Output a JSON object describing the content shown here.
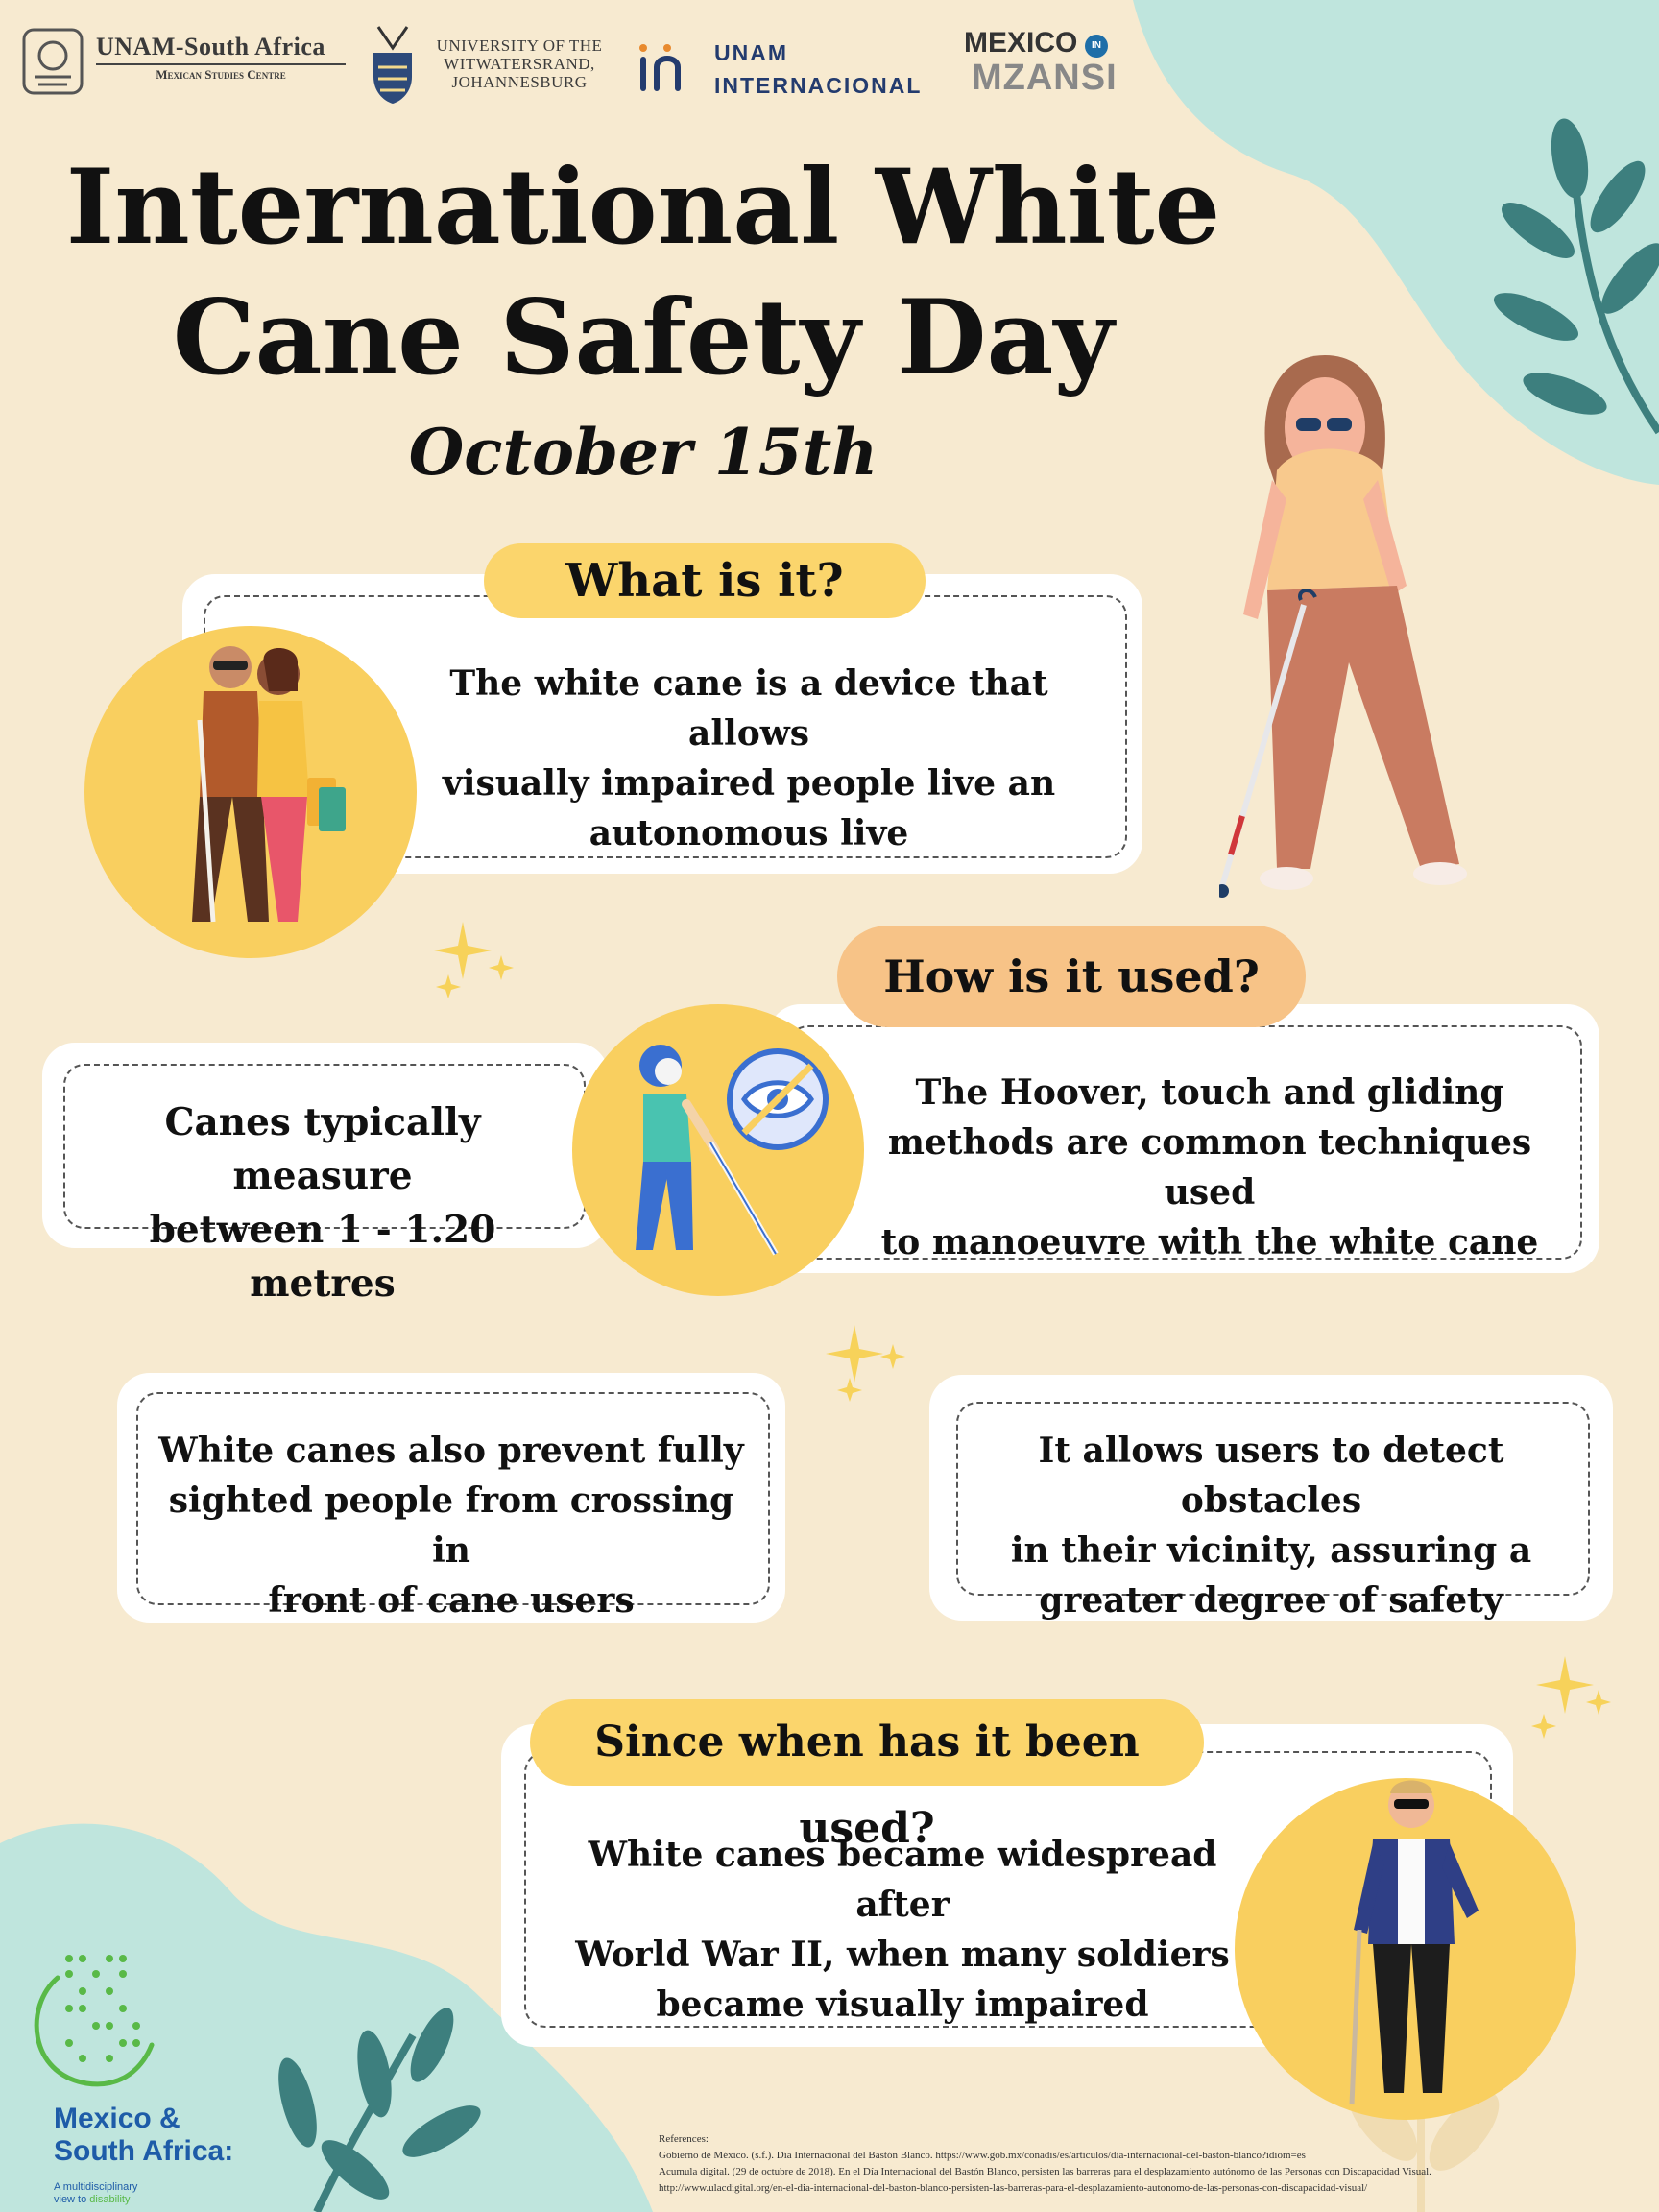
{
  "header": {
    "unam_name": "UNAM-South Africa",
    "unam_sub": "Mexican Studies Centre",
    "wits_lines": [
      "UNIVERSITY OF THE",
      "WITWATERSRAND,",
      "JOHANNESBURG"
    ],
    "intl_lines": [
      "UNAM",
      "INTERNACIONAL"
    ],
    "mm_top": "MEXICO",
    "mm_in": "IN",
    "mm_bottom": "MZANSI"
  },
  "title_lines": [
    "International White",
    "Cane Safety Day"
  ],
  "date": "October 15th",
  "sections": {
    "what": {
      "heading": "What is it?",
      "body_lines": [
        "The white cane is a device that allows",
        "visually impaired people live an",
        "autonomous live"
      ]
    },
    "how": {
      "heading": "How is it used?",
      "measure_lines": [
        "Canes typically measure",
        "between 1 - 1.20 metres"
      ],
      "methods_lines": [
        "The Hoover, touch and gliding",
        "methods are common techniques used",
        "to manoeuvre with the white cane"
      ]
    },
    "prevent_lines": [
      "White canes also prevent fully",
      "sighted people from crossing in",
      "front of cane users"
    ],
    "detect_lines": [
      "It allows users to detect obstacles",
      "in their vicinity, assuring a",
      "greater degree of safety"
    ],
    "since": {
      "heading": "Since when has it been used?",
      "body_lines": [
        "White canes became widespread after",
        "World War II, when many soldiers",
        "became visually impaired"
      ]
    }
  },
  "footer": {
    "msa_line1": "Mexico &",
    "msa_line2": "South Africa:",
    "msa_tag1": "A multidisciplinary",
    "msa_tag2a": "view to ",
    "msa_tag2b": "disability",
    "references": [
      "References:",
      "Gobierno de México. (s.f.). Día Internacional del Bastón Blanco. https://www.gob.mx/conadis/es/articulos/dia-internacional-del-baston-blanco?idiom=es",
      "Acumula digital. (29 de octubre de 2018). En el Día Internacional del Bastón Blanco, persisten las barreras para el desplazamiento autónomo de las Personas con Discapacidad Visual.",
      "http://www.ulacdigital.org/en-el-dia-internacional-del-baston-blanco-persisten-las-barreras-para-el-desplazamiento-autonomo-de-las-personas-con-discapacidad-visual/"
    ]
  },
  "colors": {
    "background": "#f7ead0",
    "mint": "#bfe5dd",
    "yellow": "#f9cf5f",
    "peach": "#f7c387",
    "leaf": "#3d7f7e",
    "card": "#ffffff",
    "star": "#f7d25a"
  }
}
